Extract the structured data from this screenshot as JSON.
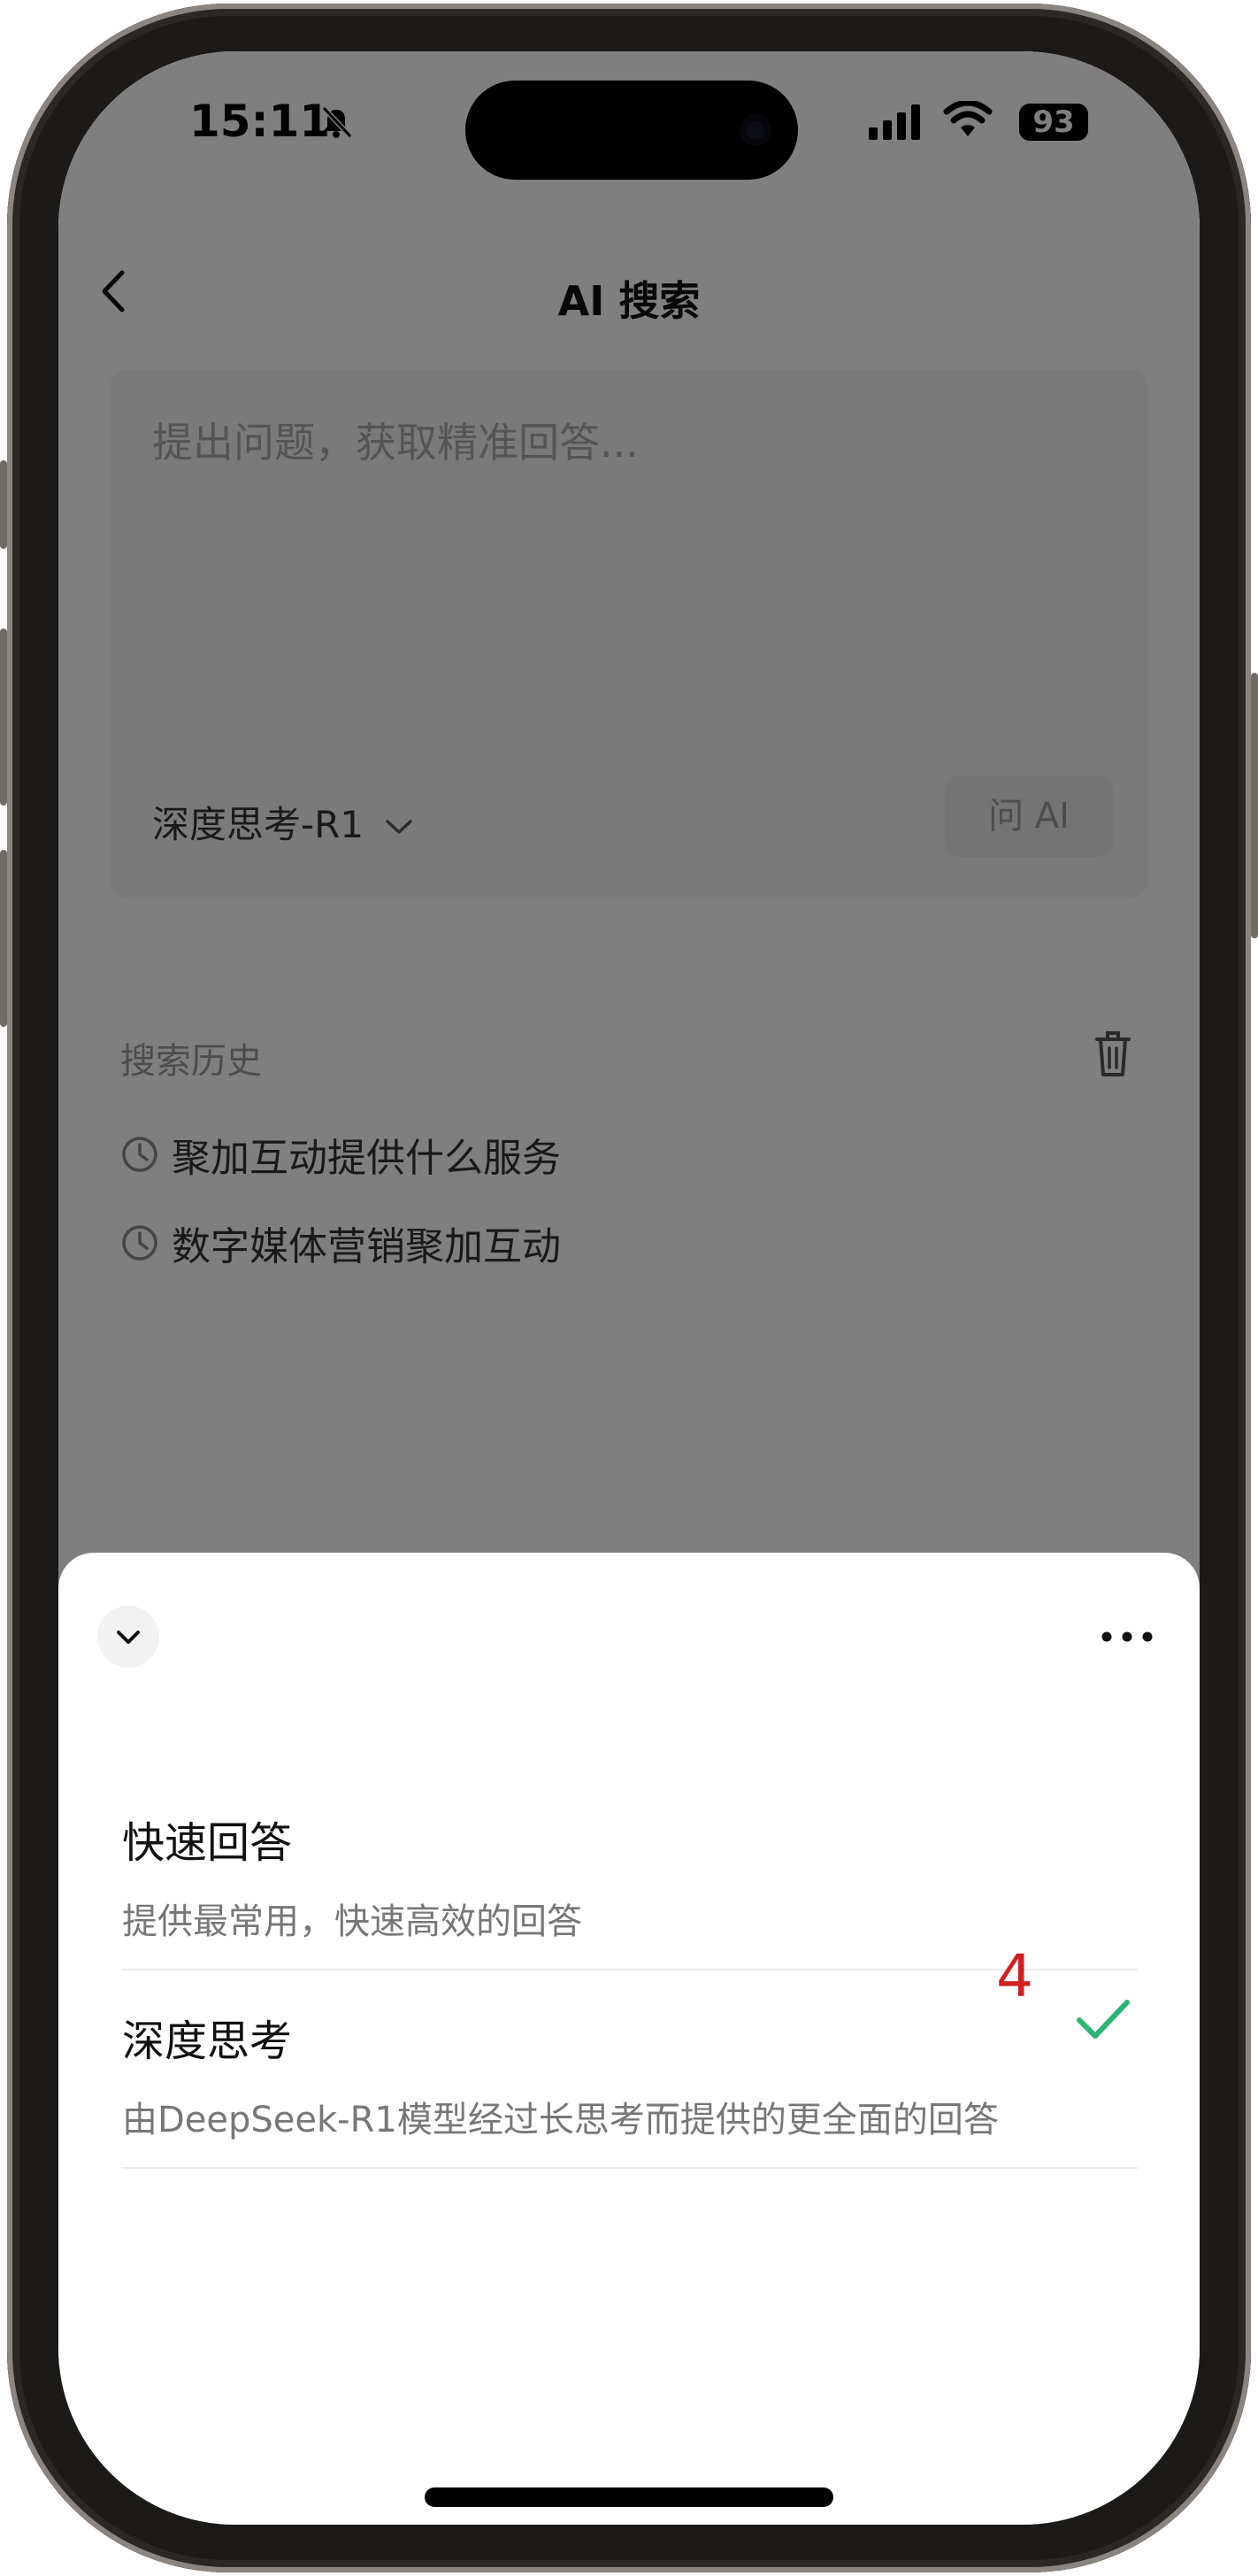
{
  "status": {
    "time": "15:11",
    "battery": "93",
    "mute_icon": "bell-slash-icon"
  },
  "header": {
    "title": "AI 搜索",
    "back_icon": "chevron-left-icon"
  },
  "query": {
    "placeholder": "提出问题，获取精准回答...",
    "model_label": "深度思考-R1",
    "ask_label": "问 AI"
  },
  "history": {
    "title": "搜索历史",
    "items": [
      "聚加互动提供什么服务",
      "数字媒体营销聚加互动"
    ]
  },
  "sheet": {
    "options": [
      {
        "title": "快速回答",
        "desc": "提供最常用，快速高效的回答"
      },
      {
        "title": "深度思考",
        "desc": "由DeepSeek-R1模型经过长思考而提供的更全面的回答",
        "selected": true
      }
    ],
    "marker": "4"
  },
  "colors": {
    "accent": "#2bb673",
    "marker": "#d21f1f"
  }
}
